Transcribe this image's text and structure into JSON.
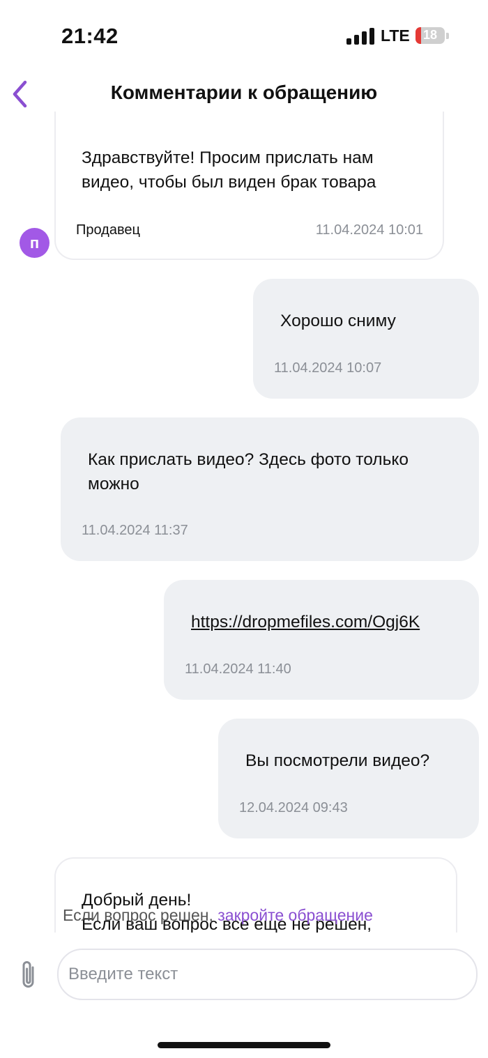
{
  "status_bar": {
    "time": "21:42",
    "network": "LTE",
    "battery": "18",
    "battery_level": 0.18
  },
  "header": {
    "title": "Комментарии к обращению",
    "back_icon": "chevron-left-icon",
    "accent": "#8a4fd1"
  },
  "messages": [
    {
      "direction": "incoming",
      "text": "Здравствуйте! Просим прислать нам видео, чтобы был виден брак товара",
      "author": "Продавец",
      "avatar_letter": "п",
      "time": "11.04.2024 10:01"
    },
    {
      "direction": "outgoing",
      "text": "Хорошо сниму",
      "time": "11.04.2024 10:07"
    },
    {
      "direction": "outgoing",
      "text": "Как прислать видео? Здесь фото только можно",
      "time": "11.04.2024 11:37"
    },
    {
      "direction": "outgoing",
      "link": "https://dropmefiles.com/Ogj6K",
      "time": "11.04.2024 11:40"
    },
    {
      "direction": "outgoing",
      "text": "Вы посмотрели видео?",
      "time": "12.04.2024 09:43"
    },
    {
      "direction": "incoming",
      "text_line1": "Добрый день!",
      "text_line2": "Если ваш вопрос все еще не решен,"
    }
  ],
  "hint": {
    "text": "Если вопрос решен, ",
    "link": "закройте обращение"
  },
  "composer": {
    "placeholder": "Введите текст",
    "attach_icon": "paperclip-icon"
  }
}
